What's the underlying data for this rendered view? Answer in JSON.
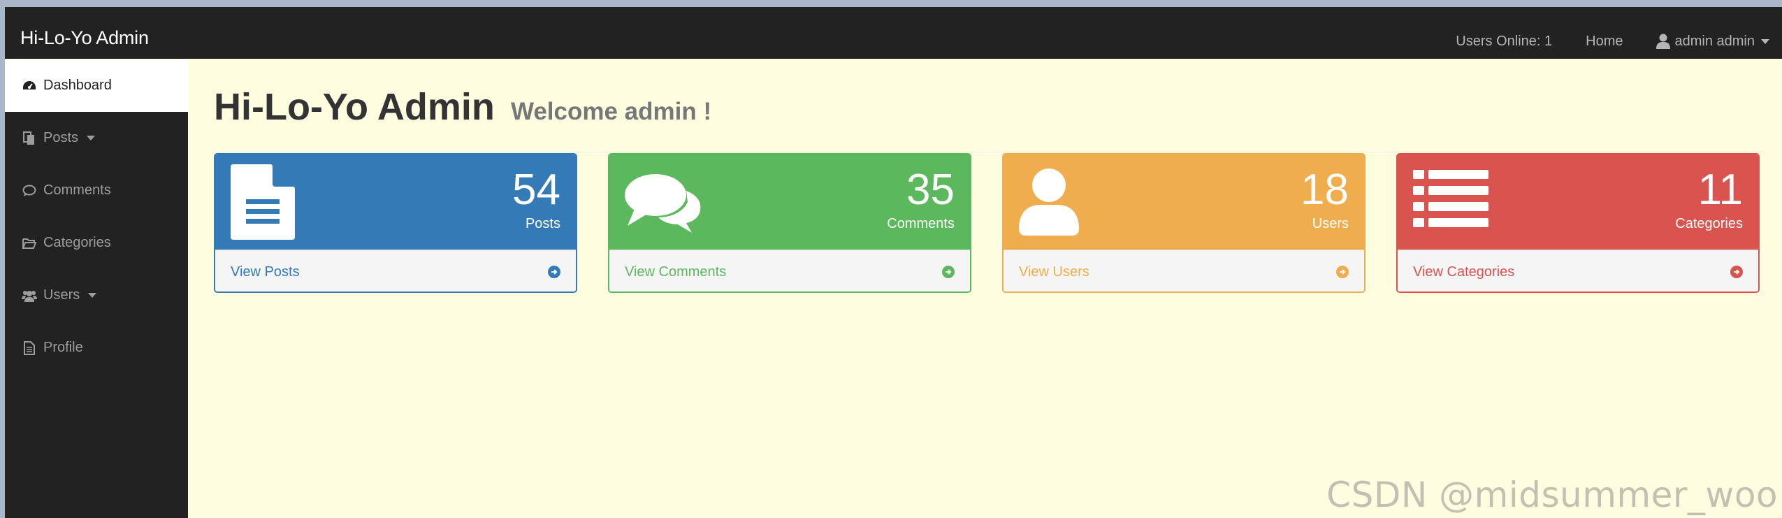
{
  "navbar": {
    "brand": "Hi-Lo-Yo Admin",
    "users_online": "Users Online: 1",
    "home": "Home",
    "user_menu": "admin admin"
  },
  "sidebar": {
    "items": [
      {
        "label": "Dashboard",
        "icon": "dashboard-icon",
        "active": true
      },
      {
        "label": "Posts",
        "icon": "files-icon",
        "dropdown": true
      },
      {
        "label": "Comments",
        "icon": "comment-icon"
      },
      {
        "label": "Categories",
        "icon": "folder-open-icon"
      },
      {
        "label": "Users",
        "icon": "users-icon",
        "dropdown": true
      },
      {
        "label": "Profile",
        "icon": "file-text-icon"
      }
    ]
  },
  "header": {
    "title": "Hi-Lo-Yo Admin",
    "subtitle": "Welcome admin !"
  },
  "panels": [
    {
      "count": "54",
      "label": "Posts",
      "link": "View Posts",
      "icon": "file-text-icon",
      "color": "#337ab7"
    },
    {
      "count": "35",
      "label": "Comments",
      "link": "View Comments",
      "icon": "comments-icon",
      "color": "#5cb85c"
    },
    {
      "count": "18",
      "label": "Users",
      "link": "View Users",
      "icon": "user-icon",
      "color": "#f0ad4e"
    },
    {
      "count": "11",
      "label": "Categories",
      "link": "View Categories",
      "icon": "list-icon",
      "color": "#d9534f"
    }
  ],
  "watermark": "CSDN @midsummer_woo"
}
